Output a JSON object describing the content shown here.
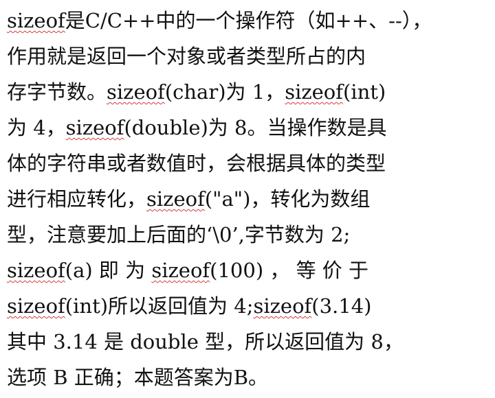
{
  "document": {
    "lines": [
      "sizeof是C/C++中的一个操作符（如++、--），",
      "作用就是返回一个对象或者类型所占的内",
      "存字节数。sizeof(char)为 1，sizeof(int)",
      "为 4，sizeof(double)为 8。当操作数是具",
      "体的字符串或者数值时，会根据具体的类型",
      "进行相应转化，sizeof(\"a\")，转化为数组",
      "型，注意要加上后面的‘\\0’,字节数为 2;",
      "sizeof(a) 即 为 sizeof(100) ， 等 价 于",
      "sizeof(int)所以返回值为 4;sizeof(3.14)",
      "其中 3.14 是 double 型，所以返回值为 8，",
      "选项 B 正确；本题答案为B。"
    ]
  },
  "colors": {
    "text": "#111111",
    "spellcheck_underline": "#d23a3a",
    "background": "#ffffff"
  }
}
